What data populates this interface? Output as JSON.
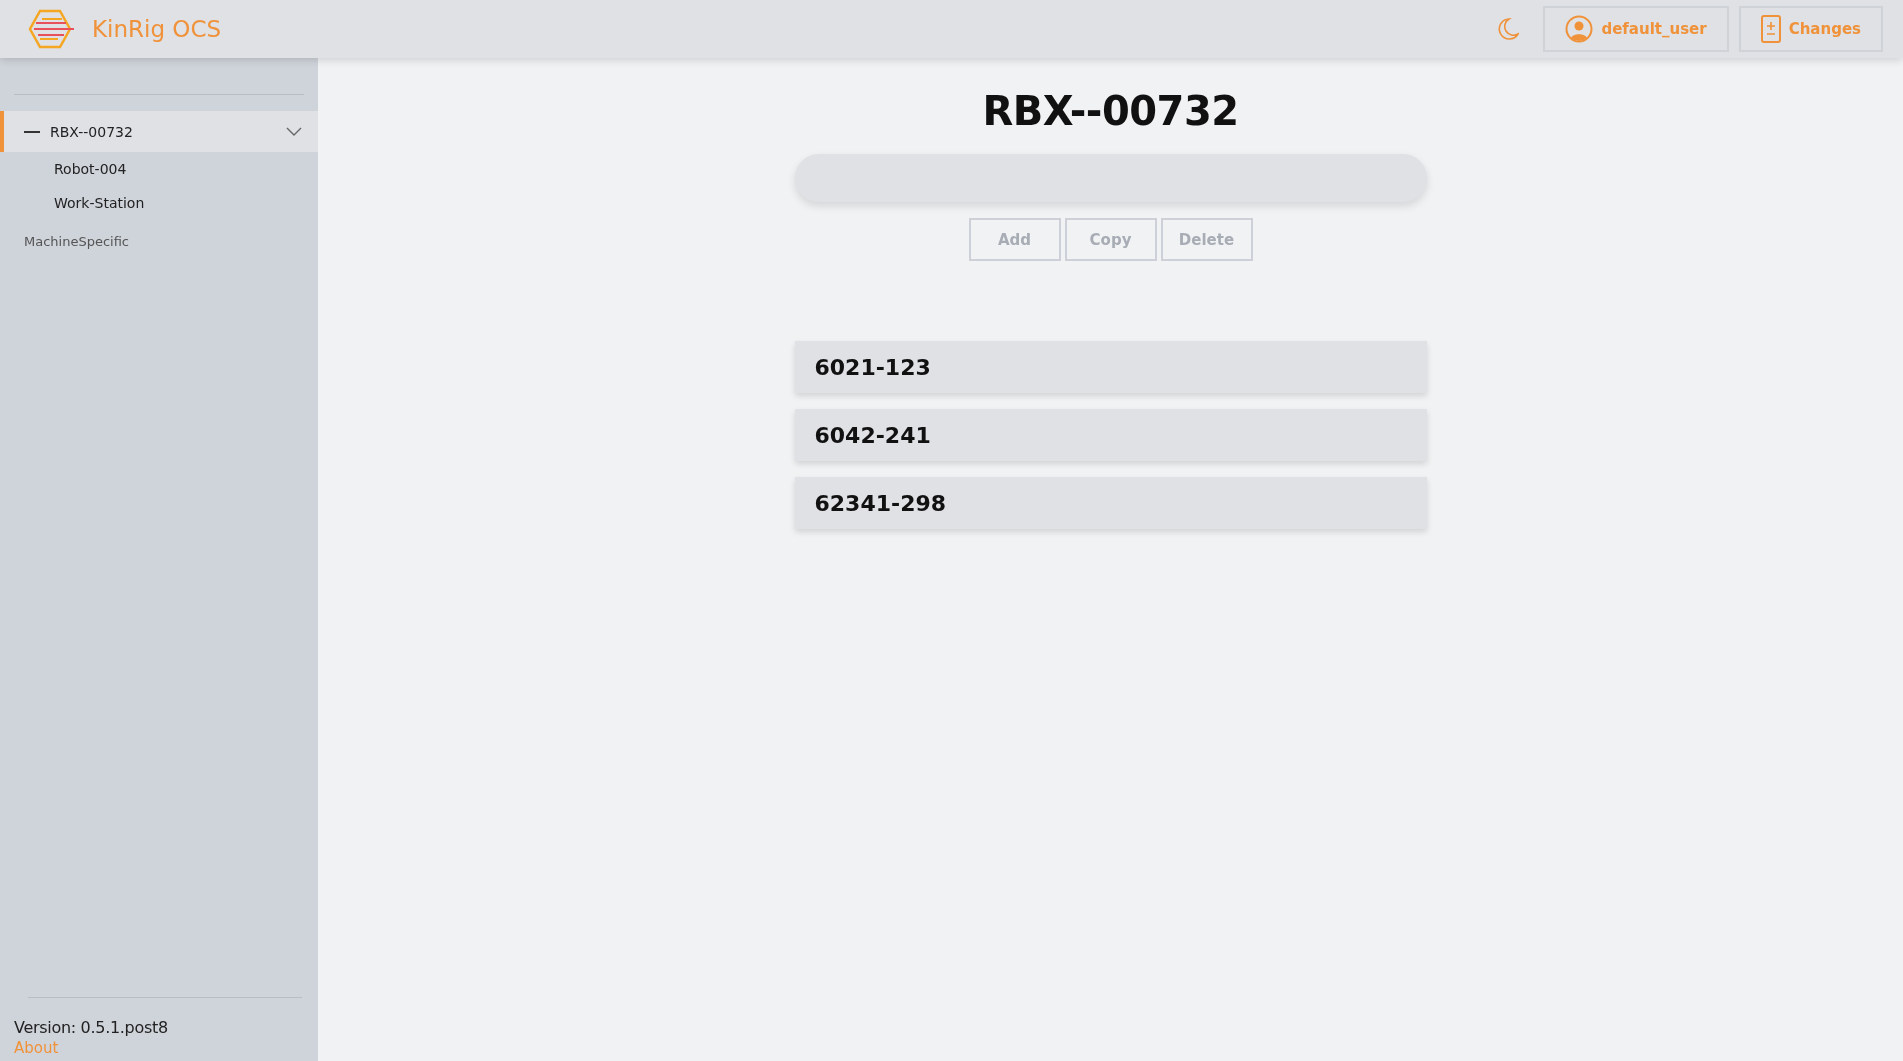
{
  "header": {
    "app_name": "KinRig OCS",
    "user": "default_user",
    "changes_button": "Changes"
  },
  "sidebar": {
    "tree": [
      {
        "label": "RBX--00732",
        "selected": true,
        "expanded": true,
        "children": [
          {
            "label": "Robot-004",
            "selected": false
          },
          {
            "label": "Work-Station",
            "selected": false
          }
        ]
      }
    ],
    "sections": [
      {
        "label": "MachineSpecific"
      }
    ],
    "version": "Version: 0.5.1.post8",
    "about_link": "About"
  },
  "main": {
    "title": "RBX--00732",
    "actions": [
      {
        "label": "Add",
        "disabled": true
      },
      {
        "label": "Copy",
        "disabled": true
      },
      {
        "label": "Delete",
        "disabled": true
      }
    ],
    "items": [
      {
        "label": "6021-123"
      },
      {
        "label": "6042-241"
      },
      {
        "label": "62341-298"
      }
    ]
  }
}
